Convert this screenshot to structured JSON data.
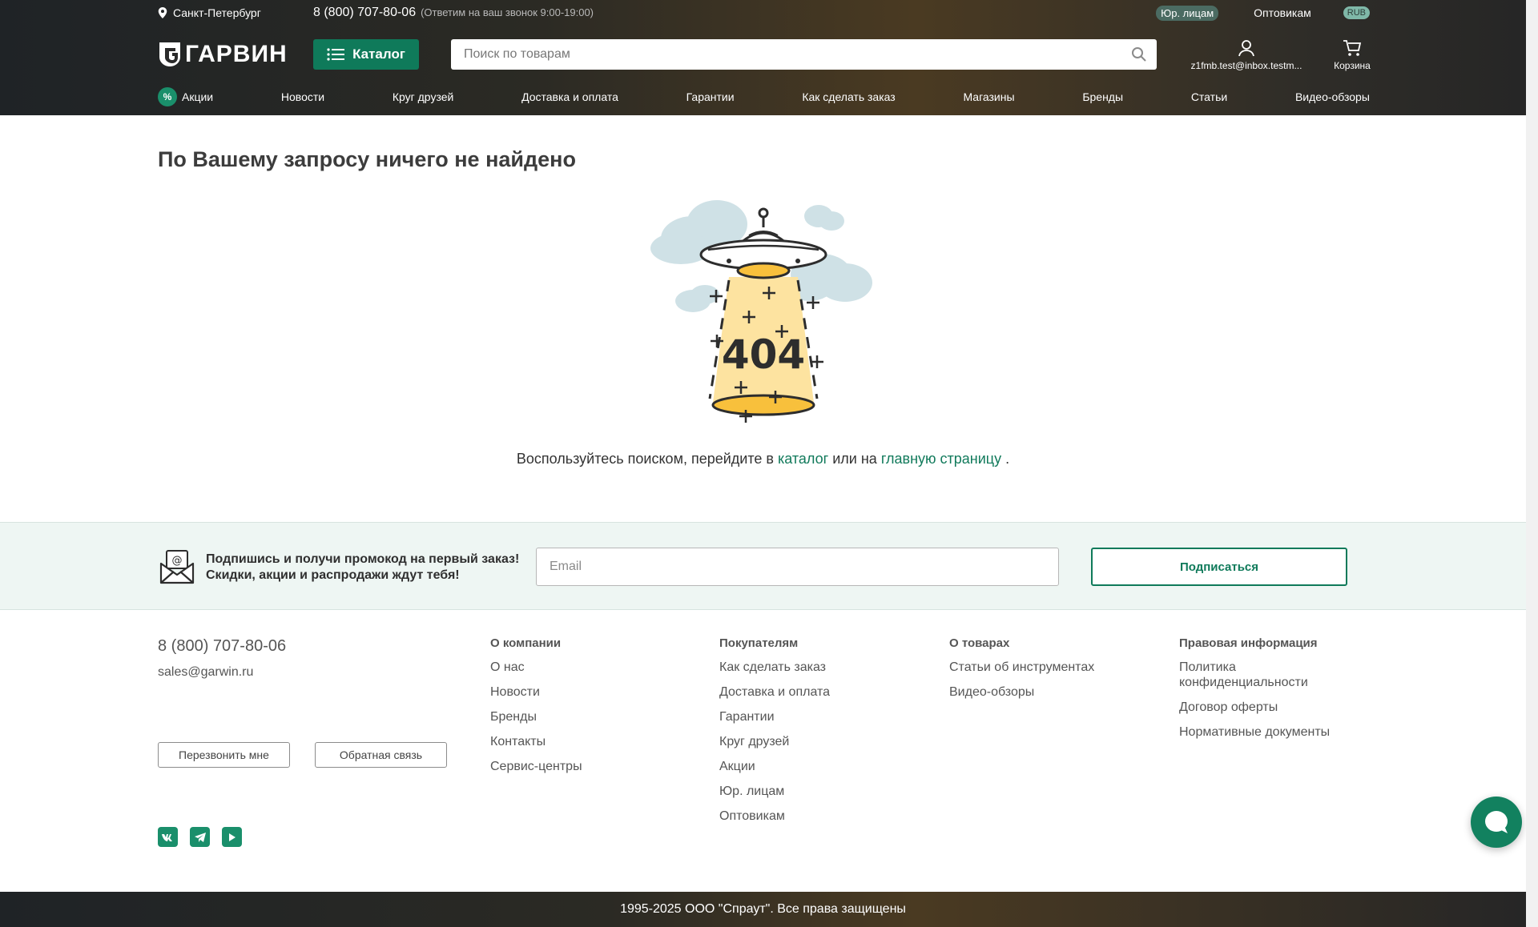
{
  "header": {
    "city": "Санкт-Петербург",
    "phone": "8 (800) 707-80-06",
    "phone_note": "(Ответим на ваш звонок 9:00-19:00)",
    "legal_entities": "Юр. лицам",
    "wholesale": "Оптовикам",
    "currency": "RUB",
    "logo_text": "ГАРВИН",
    "catalog_label": "Каталог",
    "search_placeholder": "Поиск по товарам",
    "account_label": "z1fmb.test@inbox.testm...",
    "cart_label": "Корзина"
  },
  "nav": [
    "Акции",
    "Новости",
    "Круг друзей",
    "Доставка и оплата",
    "Гарантии",
    "Как сделать заказ",
    "Магазины",
    "Бренды",
    "Статьи",
    "Видео-обзоры"
  ],
  "main": {
    "title": "По Вашему запросу ничего не найдено",
    "error_code": "404",
    "hint_before": "Воспользуйтесь поиском, перейдите в",
    "hint_link1": "каталог",
    "hint_middle": "или на",
    "hint_link2": "главную страницу",
    "hint_after": "."
  },
  "subscribe": {
    "line1": "Подпишись и получи промокод на первый заказ!",
    "line2": "Скидки, акции и распродажи ждут тебя!",
    "email_placeholder": "Email",
    "button": "Подписаться"
  },
  "footer": {
    "phone": "8 (800) 707-80-06",
    "email": "sales@garwin.ru",
    "callback": "Перезвонить мне",
    "feedback": "Обратная связь",
    "columns": [
      {
        "title": "О компании",
        "links": [
          "О нас",
          "Новости",
          "Бренды",
          "Контакты",
          "Сервис-центры"
        ]
      },
      {
        "title": "Покупателям",
        "links": [
          "Как сделать заказ",
          "Доставка и оплата",
          "Гарантии",
          "Круг друзей",
          "Акции",
          "Юр. лицам",
          "Оптовикам"
        ]
      },
      {
        "title": "О товарах",
        "links": [
          "Статьи об инструментах",
          "Видео-обзоры"
        ]
      },
      {
        "title": "Правовая информация",
        "links": [
          "Политика конфиденциальности",
          "Договор оферты",
          "Нормативные документы"
        ]
      }
    ],
    "socials": [
      "vk",
      "telegram",
      "youtube"
    ],
    "copyright": "1995-2025 ООО \"Спраут\". Все права защищены"
  },
  "colors": {
    "accent": "#0f7a5a",
    "link": "#117a5b"
  }
}
